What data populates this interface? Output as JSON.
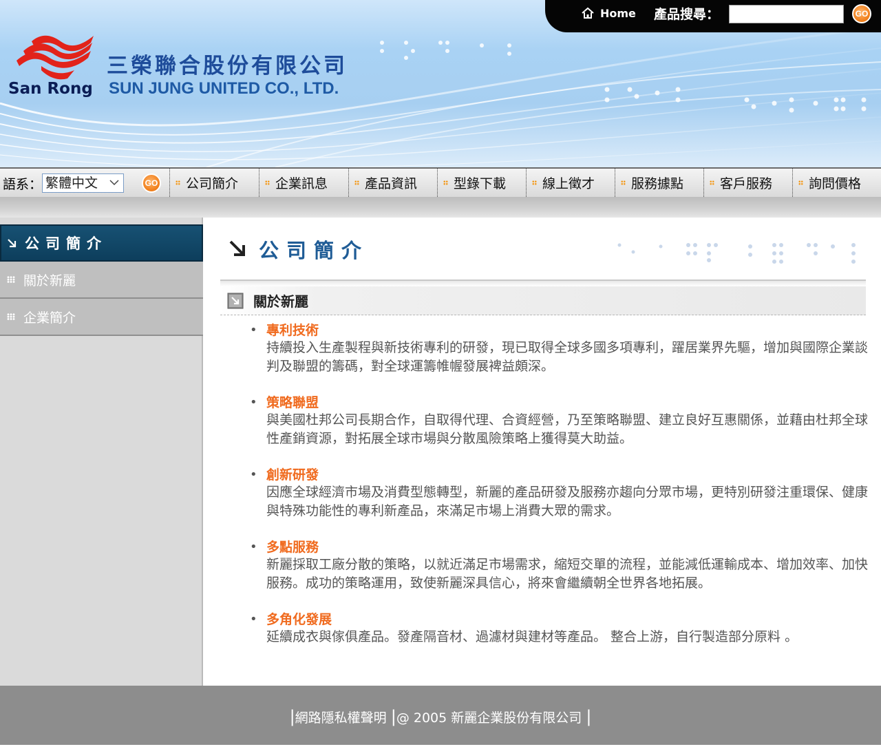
{
  "header": {
    "logo_text": "San Rong",
    "company_name_zh": "三榮聯合股份有限公司",
    "company_name_en": "SUN JUNG UNITED CO., LTD.",
    "home_label": "Home",
    "search_label": "產品搜尋：",
    "search_value": "",
    "go_label": "GO"
  },
  "navbar": {
    "language_label": "語系：",
    "language_selected": "繁體中文",
    "go_label": "GO",
    "items": [
      {
        "label": "公司簡介"
      },
      {
        "label": "企業訊息"
      },
      {
        "label": "產品資訊"
      },
      {
        "label": "型錄下載"
      },
      {
        "label": "線上徵才"
      },
      {
        "label": "服務據點"
      },
      {
        "label": "客戶服務"
      },
      {
        "label": "詢問價格"
      }
    ]
  },
  "sidebar": {
    "heading": "公司簡介",
    "items": [
      {
        "label": "關於新麗"
      },
      {
        "label": "企業簡介"
      }
    ]
  },
  "main": {
    "title": "公司簡介",
    "section_title": "關於新麗",
    "features": [
      {
        "title": "專利技術",
        "desc": "持續投入生產製程與新技術專利的研發，現已取得全球多國多項專利，躍居業界先驅，增加與國際企業談判及聯盟的籌碼，對全球運籌帷幄發展裨益頗深。"
      },
      {
        "title": "策略聯盟",
        "desc": "與美國杜邦公司長期合作，自取得代理、合資經營，乃至策略聯盟、建立良好互惠關係，並藉由杜邦全球性產銷資源，對拓展全球市場與分散風險策略上獲得莫大助益。"
      },
      {
        "title": "創新研發",
        "desc": "因應全球經濟市場及消費型態轉型，新麗的產品研發及服務亦趨向分眾市場，更特別研發注重環保、健康與特殊功能性的專利新產品，來滿足市場上消費大眾的需求。"
      },
      {
        "title": "多點服務",
        "desc": "新麗採取工廠分散的策略，以就近滿足市場需求，縮短交單的流程，並能減低運輸成本、增加效率、加快服務。成功的策略運用，致使新麗深具信心，將來會繼續朝全世界各地拓展。"
      },
      {
        "title": "多角化發展",
        "desc": "延續成衣與傢俱產品。發產隔音材、過濾材與建材等產品。 整合上游，自行製造部分原料 。"
      }
    ]
  },
  "footer": {
    "privacy_link": "網路隱私權聲明",
    "copyright": "@ 2005 新麗企業股份有限公司"
  },
  "colors": {
    "accent_orange": "#f06b1f",
    "title_blue": "#1f5c96",
    "sidebar_head": "#0d3e5c",
    "footer_gray": "#8d8d8d"
  }
}
